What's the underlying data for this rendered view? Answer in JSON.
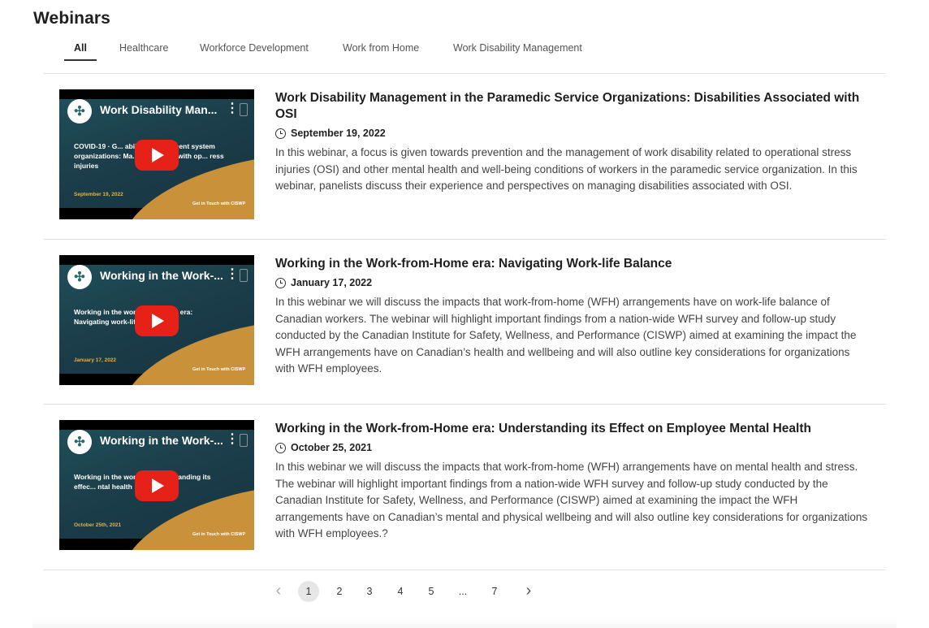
{
  "page": {
    "title": "Webinars"
  },
  "tabs": [
    {
      "label": "All",
      "active": true
    },
    {
      "label": "Healthcare",
      "active": false
    },
    {
      "label": "Workforce Development",
      "active": false
    },
    {
      "label": "Work from Home",
      "active": false
    },
    {
      "label": "Work Disability Management",
      "active": false
    }
  ],
  "webinars": [
    {
      "title": "Work Disability Management in the Paramedic Service Organizations: Disabilities Associated with OSI",
      "date": "September 19, 2022",
      "description": "In this webinar, a focus is given towards prevention and the management of work disability related to operational stress injuries (OSI) and other mental health and well-being conditions of workers in the paramedic service organization. In this webinar, panelists discuss their experience and perspectives on managing disabilities associated with OSI.",
      "video": {
        "title": "Work Disability Man...",
        "slide_text": "COVID-19 · G... ability management system organizations: Ma... associated with op... ress injuries",
        "slide_date": "September 19, 2022",
        "cta": "Get in Touch with CISWP"
      }
    },
    {
      "title": "Working in the Work-from-Home era: Navigating Work-life Balance",
      "date": "January 17, 2022",
      "description": "In this webinar we will discuss the impacts that work-from-home (WFH) arrangements have on work-life balance of Canadian workers. The webinar will highlight important findings from a nation-wide WFH survey and follow-up study conducted by the Canadian Institute for Safety, Wellness, and Performance (CISWP) aimed at examining the impact the WFH arrangements have on Canadian’s health and wellbeing and will also outline key considerations for organizations with WFH employees.",
      "video": {
        "title": "Working in the Work-...",
        "slide_text": "Working in the work-from-home era: Navigating work-life bala...",
        "slide_date": "January 17, 2022",
        "cta": "Get in Touch with CISWP"
      }
    },
    {
      "title": "Working in the Work-from-Home era: Understanding its Effect on Employee Mental Health",
      "date": "October 25, 2021",
      "description": "In this webinar we will discuss the impacts that work-from-home (WFH) arrangements have on mental health and stress. The webinar will highlight important findings from a nation-wide WFH survey and follow-up study conducted by the Canadian Institute for Safety, Wellness, and Performance (CISWP) aimed at examining the impact the WFH arrangements have on Canadian’s mental and physical wellbeing and will also outline key considerations for organizations with WFH employees.?",
      "video": {
        "title": "Working in the Work-...",
        "slide_text": "Working in the work-f... Understanding its effec... ntal health",
        "slide_date": "October 25th, 2021",
        "cta": "Get in Touch with CISWP"
      }
    }
  ],
  "pagination": {
    "prev": "‹",
    "pages": [
      "1",
      "2",
      "3",
      "4",
      "5",
      "...",
      "7"
    ],
    "current": "1",
    "next": "›"
  }
}
